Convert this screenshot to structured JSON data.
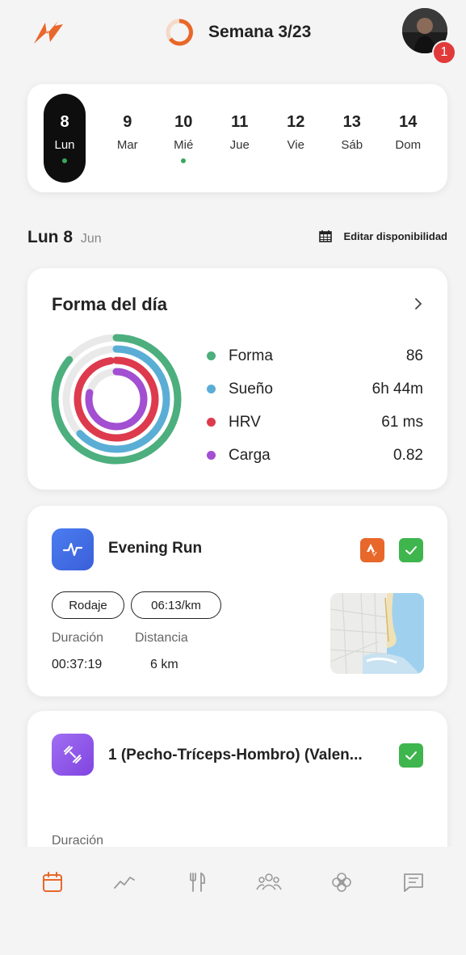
{
  "header": {
    "week_label": "Semana 3/23",
    "notification_count": "1",
    "accent_color": "#e8672a"
  },
  "days": [
    {
      "num": "8",
      "name": "Lun",
      "active": true,
      "has_activity": true
    },
    {
      "num": "9",
      "name": "Mar",
      "active": false,
      "has_activity": false
    },
    {
      "num": "10",
      "name": "Mié",
      "active": false,
      "has_activity": true
    },
    {
      "num": "11",
      "name": "Jue",
      "active": false,
      "has_activity": false
    },
    {
      "num": "12",
      "name": "Vie",
      "active": false,
      "has_activity": false
    },
    {
      "num": "13",
      "name": "Sáb",
      "active": false,
      "has_activity": false
    },
    {
      "num": "14",
      "name": "Dom",
      "active": false,
      "has_activity": false
    }
  ],
  "date_row": {
    "day": "Lun 8",
    "month": "Jun",
    "edit_label": "Editar disponibilidad"
  },
  "forma": {
    "title": "Forma del día",
    "metrics": [
      {
        "label": "Forma",
        "value": "86",
        "color": "#4caf7d"
      },
      {
        "label": "Sueño",
        "value": "6h 44m",
        "color": "#5aaed6"
      },
      {
        "label": "HRV",
        "value": "61 ms",
        "color": "#dd3b4d"
      },
      {
        "label": "Carga",
        "value": "0.82",
        "color": "#a24fd1"
      }
    ]
  },
  "run": {
    "title": "Evening Run",
    "tag_type": "Rodaje",
    "tag_pace": "06:13/km",
    "duration_label": "Duración",
    "distance_label": "Distancia",
    "duration_value": "00:37:19",
    "distance_value": "6 km"
  },
  "gym": {
    "title": "1 (Pecho-Tríceps-Hombro) (Valen...",
    "duration_label": "Duración"
  },
  "nav": [
    "calendar-icon",
    "trend-icon",
    "nutrition-icon",
    "community-icon",
    "flower-icon",
    "chat-icon"
  ]
}
